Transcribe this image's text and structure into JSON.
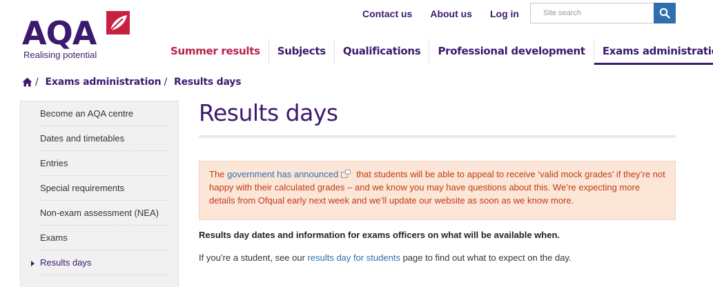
{
  "brand": {
    "logo_text": "AQA",
    "tagline": "Realising potential",
    "accent": "#3b1a6e",
    "secondary": "#b8224b",
    "link": "#2e6fae"
  },
  "utility_nav": {
    "contact": "Contact us",
    "about": "About us",
    "login": "Log in"
  },
  "search": {
    "placeholder": "Site search",
    "button_icon": "search-icon"
  },
  "main_nav": {
    "items": [
      {
        "label": "Summer results"
      },
      {
        "label": "Subjects"
      },
      {
        "label": "Qualifications"
      },
      {
        "label": "Professional development"
      },
      {
        "label": "Exams administration"
      }
    ]
  },
  "breadcrumb": {
    "home_icon": "home-icon",
    "separator": "/",
    "items": [
      "Exams administration",
      "Results days"
    ]
  },
  "sidebar": {
    "items": [
      {
        "label": "Become an AQA centre"
      },
      {
        "label": "Dates and timetables"
      },
      {
        "label": "Entries"
      },
      {
        "label": "Special requirements"
      },
      {
        "label": "Non-exam assessment (NEA)"
      },
      {
        "label": "Exams"
      },
      {
        "label": "Results days"
      }
    ]
  },
  "main": {
    "title": "Results days",
    "alert": {
      "prefix": "The ",
      "link": "government has announced",
      "suffix": "that students will be able to appeal to receive ‘valid mock grades’ if they’re not happy with their calculated grades – and we know you may have questions about this. We’re expecting more details from Ofqual early next week and we’ll update our website as soon as we know more."
    },
    "lead": "Results day dates and information for exams officers on what will be available when.",
    "student_prefix": "If you’re a student, see our ",
    "student_link": "results day for students",
    "student_suffix": " page to find out what to expect on the day."
  }
}
